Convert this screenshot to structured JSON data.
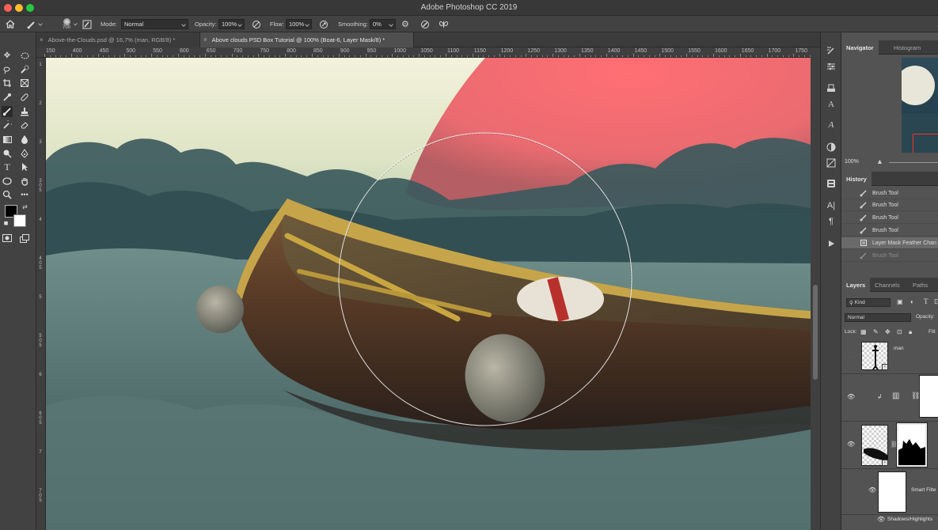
{
  "window": {
    "title": "Adobe Photoshop CC 2019"
  },
  "options": {
    "brush_size": "700",
    "mode_label": "Mode:",
    "mode_value": "Normal",
    "opacity_label": "Opacity:",
    "opacity_value": "100%",
    "flow_label": "Flow:",
    "flow_value": "100%",
    "smoothing_label": "Smoothing:",
    "smoothing_value": "0%"
  },
  "tabs": [
    {
      "label": "Above-the-Clouds.psd @ 16,7% (man, RGB/8) *",
      "active": false
    },
    {
      "label": "Above clouds PSD Box Tutorial @ 100% (Boat-6, Layer Mask/8) *",
      "active": true
    }
  ],
  "ruler_top": [
    "150",
    "400",
    "450",
    "500",
    "550",
    "600",
    "650",
    "700",
    "750",
    "800",
    "850",
    "900",
    "950",
    "1000",
    "1050",
    "1100",
    "1150",
    "1200",
    "1250",
    "1300",
    "1350",
    "1400",
    "1450",
    "1500",
    "1550",
    "1600",
    "1650",
    "1700",
    "1750"
  ],
  "ruler_left": [
    "1",
    "2",
    "3",
    "3 5",
    "4",
    "4 5",
    "5",
    "5 5",
    "6",
    "6 5",
    "7",
    "7 5"
  ],
  "navigator": {
    "tabs": [
      "Navigator",
      "Histogram"
    ],
    "zoom": "100%"
  },
  "history": {
    "title": "History",
    "items": [
      {
        "label": "Brush Tool"
      },
      {
        "label": "Brush Tool"
      },
      {
        "label": "Brush Tool"
      },
      {
        "label": "Brush Tool"
      },
      {
        "label": "Layer Mask Feather Chan"
      },
      {
        "label": "Brush Tool"
      }
    ]
  },
  "layers": {
    "tabs": [
      "Layers",
      "Channels",
      "Paths"
    ],
    "filter_kind": "Kind",
    "blend_mode": "Normal",
    "opacity_label": "Opacity:",
    "lock_label": "Lock:",
    "fill_label": "Fill:",
    "items": [
      {
        "name": "man"
      },
      {
        "name": ""
      },
      {
        "name": ""
      },
      {
        "name": "Smart Filte"
      },
      {
        "name": "Shadows/Highlights"
      }
    ]
  },
  "colors": {
    "accent_moon": "#ff6f74",
    "panel_bg": "#535353",
    "toolbar_bg": "#424242"
  }
}
